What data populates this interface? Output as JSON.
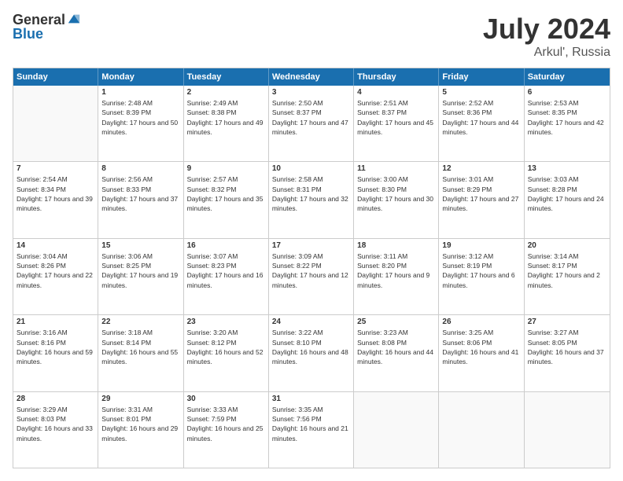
{
  "logo": {
    "general": "General",
    "blue": "Blue"
  },
  "title": "July 2024",
  "location": "Arkul', Russia",
  "header_days": [
    "Sunday",
    "Monday",
    "Tuesday",
    "Wednesday",
    "Thursday",
    "Friday",
    "Saturday"
  ],
  "weeks": [
    [
      {
        "day": "",
        "empty": true
      },
      {
        "day": "1",
        "sunrise": "Sunrise: 2:48 AM",
        "sunset": "Sunset: 8:39 PM",
        "daylight": "Daylight: 17 hours and 50 minutes."
      },
      {
        "day": "2",
        "sunrise": "Sunrise: 2:49 AM",
        "sunset": "Sunset: 8:38 PM",
        "daylight": "Daylight: 17 hours and 49 minutes."
      },
      {
        "day": "3",
        "sunrise": "Sunrise: 2:50 AM",
        "sunset": "Sunset: 8:37 PM",
        "daylight": "Daylight: 17 hours and 47 minutes."
      },
      {
        "day": "4",
        "sunrise": "Sunrise: 2:51 AM",
        "sunset": "Sunset: 8:37 PM",
        "daylight": "Daylight: 17 hours and 45 minutes."
      },
      {
        "day": "5",
        "sunrise": "Sunrise: 2:52 AM",
        "sunset": "Sunset: 8:36 PM",
        "daylight": "Daylight: 17 hours and 44 minutes."
      },
      {
        "day": "6",
        "sunrise": "Sunrise: 2:53 AM",
        "sunset": "Sunset: 8:35 PM",
        "daylight": "Daylight: 17 hours and 42 minutes."
      }
    ],
    [
      {
        "day": "7",
        "sunrise": "Sunrise: 2:54 AM",
        "sunset": "Sunset: 8:34 PM",
        "daylight": "Daylight: 17 hours and 39 minutes."
      },
      {
        "day": "8",
        "sunrise": "Sunrise: 2:56 AM",
        "sunset": "Sunset: 8:33 PM",
        "daylight": "Daylight: 17 hours and 37 minutes."
      },
      {
        "day": "9",
        "sunrise": "Sunrise: 2:57 AM",
        "sunset": "Sunset: 8:32 PM",
        "daylight": "Daylight: 17 hours and 35 minutes."
      },
      {
        "day": "10",
        "sunrise": "Sunrise: 2:58 AM",
        "sunset": "Sunset: 8:31 PM",
        "daylight": "Daylight: 17 hours and 32 minutes."
      },
      {
        "day": "11",
        "sunrise": "Sunrise: 3:00 AM",
        "sunset": "Sunset: 8:30 PM",
        "daylight": "Daylight: 17 hours and 30 minutes."
      },
      {
        "day": "12",
        "sunrise": "Sunrise: 3:01 AM",
        "sunset": "Sunset: 8:29 PM",
        "daylight": "Daylight: 17 hours and 27 minutes."
      },
      {
        "day": "13",
        "sunrise": "Sunrise: 3:03 AM",
        "sunset": "Sunset: 8:28 PM",
        "daylight": "Daylight: 17 hours and 24 minutes."
      }
    ],
    [
      {
        "day": "14",
        "sunrise": "Sunrise: 3:04 AM",
        "sunset": "Sunset: 8:26 PM",
        "daylight": "Daylight: 17 hours and 22 minutes."
      },
      {
        "day": "15",
        "sunrise": "Sunrise: 3:06 AM",
        "sunset": "Sunset: 8:25 PM",
        "daylight": "Daylight: 17 hours and 19 minutes."
      },
      {
        "day": "16",
        "sunrise": "Sunrise: 3:07 AM",
        "sunset": "Sunset: 8:23 PM",
        "daylight": "Daylight: 17 hours and 16 minutes."
      },
      {
        "day": "17",
        "sunrise": "Sunrise: 3:09 AM",
        "sunset": "Sunset: 8:22 PM",
        "daylight": "Daylight: 17 hours and 12 minutes."
      },
      {
        "day": "18",
        "sunrise": "Sunrise: 3:11 AM",
        "sunset": "Sunset: 8:20 PM",
        "daylight": "Daylight: 17 hours and 9 minutes."
      },
      {
        "day": "19",
        "sunrise": "Sunrise: 3:12 AM",
        "sunset": "Sunset: 8:19 PM",
        "daylight": "Daylight: 17 hours and 6 minutes."
      },
      {
        "day": "20",
        "sunrise": "Sunrise: 3:14 AM",
        "sunset": "Sunset: 8:17 PM",
        "daylight": "Daylight: 17 hours and 2 minutes."
      }
    ],
    [
      {
        "day": "21",
        "sunrise": "Sunrise: 3:16 AM",
        "sunset": "Sunset: 8:16 PM",
        "daylight": "Daylight: 16 hours and 59 minutes."
      },
      {
        "day": "22",
        "sunrise": "Sunrise: 3:18 AM",
        "sunset": "Sunset: 8:14 PM",
        "daylight": "Daylight: 16 hours and 55 minutes."
      },
      {
        "day": "23",
        "sunrise": "Sunrise: 3:20 AM",
        "sunset": "Sunset: 8:12 PM",
        "daylight": "Daylight: 16 hours and 52 minutes."
      },
      {
        "day": "24",
        "sunrise": "Sunrise: 3:22 AM",
        "sunset": "Sunset: 8:10 PM",
        "daylight": "Daylight: 16 hours and 48 minutes."
      },
      {
        "day": "25",
        "sunrise": "Sunrise: 3:23 AM",
        "sunset": "Sunset: 8:08 PM",
        "daylight": "Daylight: 16 hours and 44 minutes."
      },
      {
        "day": "26",
        "sunrise": "Sunrise: 3:25 AM",
        "sunset": "Sunset: 8:06 PM",
        "daylight": "Daylight: 16 hours and 41 minutes."
      },
      {
        "day": "27",
        "sunrise": "Sunrise: 3:27 AM",
        "sunset": "Sunset: 8:05 PM",
        "daylight": "Daylight: 16 hours and 37 minutes."
      }
    ],
    [
      {
        "day": "28",
        "sunrise": "Sunrise: 3:29 AM",
        "sunset": "Sunset: 8:03 PM",
        "daylight": "Daylight: 16 hours and 33 minutes."
      },
      {
        "day": "29",
        "sunrise": "Sunrise: 3:31 AM",
        "sunset": "Sunset: 8:01 PM",
        "daylight": "Daylight: 16 hours and 29 minutes."
      },
      {
        "day": "30",
        "sunrise": "Sunrise: 3:33 AM",
        "sunset": "Sunset: 7:59 PM",
        "daylight": "Daylight: 16 hours and 25 minutes."
      },
      {
        "day": "31",
        "sunrise": "Sunrise: 3:35 AM",
        "sunset": "Sunset: 7:56 PM",
        "daylight": "Daylight: 16 hours and 21 minutes."
      },
      {
        "day": "",
        "empty": true
      },
      {
        "day": "",
        "empty": true
      },
      {
        "day": "",
        "empty": true
      }
    ]
  ]
}
